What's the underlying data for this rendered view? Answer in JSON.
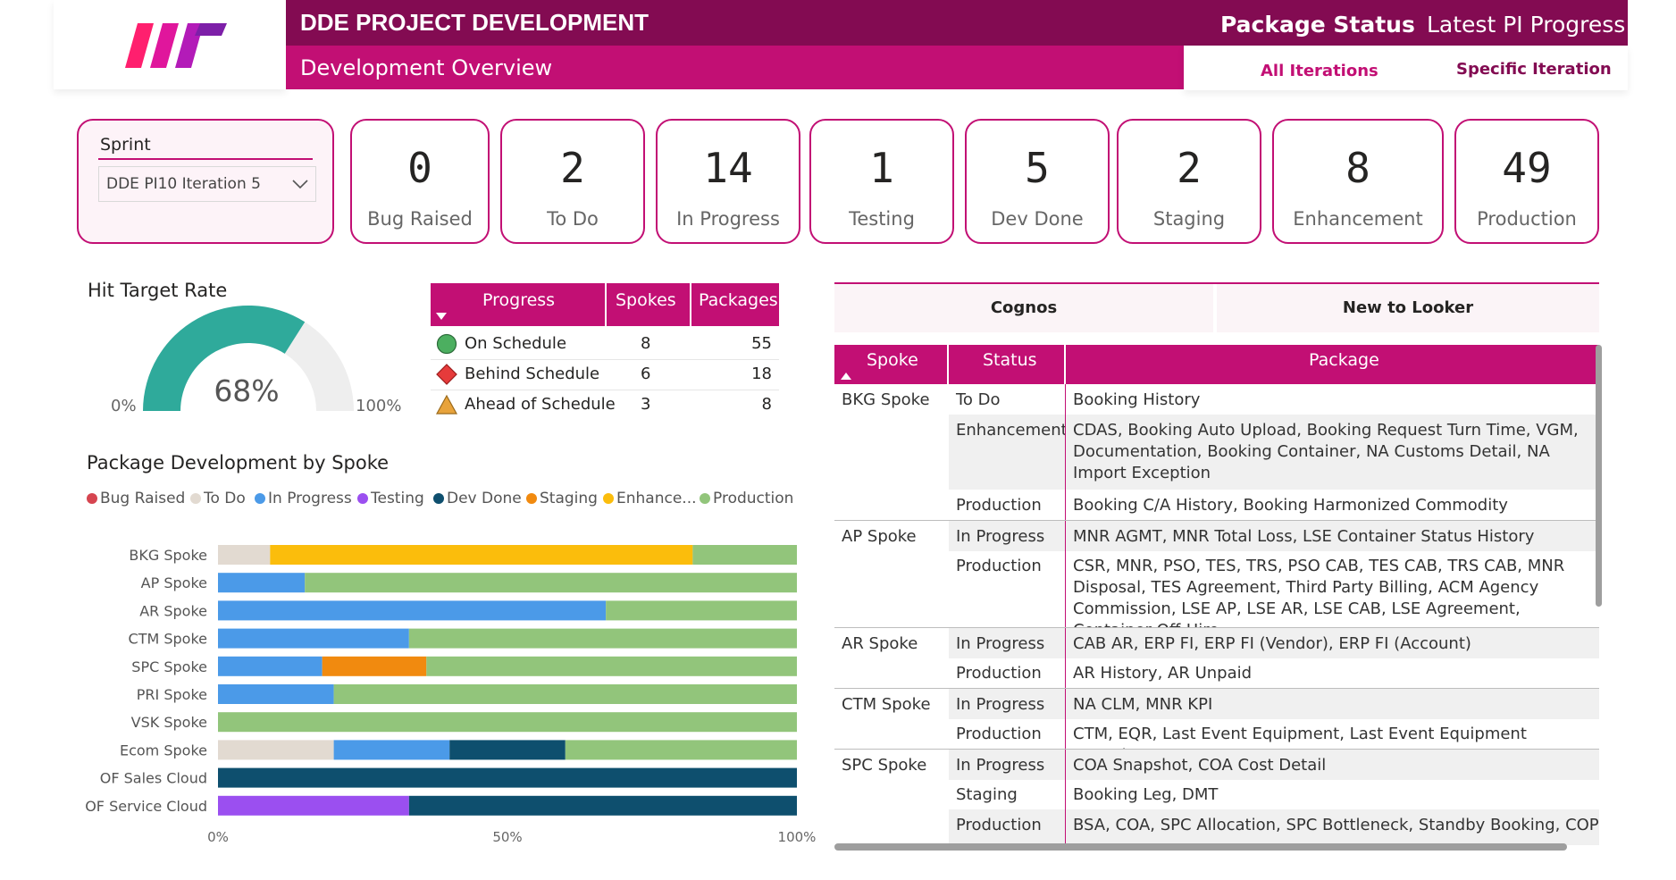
{
  "header": {
    "title": "DDE PROJECT DEVELOPMENT",
    "subtitle": "Development Overview",
    "nav": {
      "package_status": "Package Status",
      "latest_pi": "Latest PI Progress"
    },
    "tabs": {
      "all_iterations": "All Iterations",
      "specific_iteration": "Specific Iteration"
    }
  },
  "sprint": {
    "label": "Sprint",
    "value": "DDE PI10 Iteration 5"
  },
  "kpis": [
    {
      "value": "0",
      "label": "Bug Raised"
    },
    {
      "value": "2",
      "label": "To Do"
    },
    {
      "value": "14",
      "label": "In Progress"
    },
    {
      "value": "1",
      "label": "Testing"
    },
    {
      "value": "5",
      "label": "Dev Done"
    },
    {
      "value": "2",
      "label": "Staging"
    },
    {
      "value": "8",
      "label": "Enhancement"
    },
    {
      "value": "49",
      "label": "Production"
    }
  ],
  "gauge": {
    "title": "Hit Target Rate",
    "value_label": "68%",
    "value": 68,
    "min_label": "0%",
    "max_label": "100%",
    "color": "#2faa9b"
  },
  "progress_table": {
    "headers": {
      "progress": "Progress",
      "spokes": "Spokes",
      "packages": "Packages"
    },
    "rows": [
      {
        "label": "On Schedule",
        "spokes": "8",
        "packages": "55",
        "icon": "green-circle-icon"
      },
      {
        "label": "Behind Schedule",
        "spokes": "6",
        "packages": "18",
        "icon": "red-diamond-icon"
      },
      {
        "label": "Ahead of Schedule",
        "spokes": "3",
        "packages": "8",
        "icon": "orange-triangle-icon"
      }
    ]
  },
  "chart_data": {
    "type": "bar",
    "orientation": "horizontal-stacked-100",
    "title": "Package Development by Spoke",
    "categories": [
      "BKG Spoke",
      "AP Spoke",
      "AR Spoke",
      "CTM Spoke",
      "SPC Spoke",
      "PRI Spoke",
      "VSK Spoke",
      "Ecom Spoke",
      "OF Sales Cloud",
      "OF Service Cloud"
    ],
    "series": [
      {
        "name": "Bug Raised",
        "color": "#d64550",
        "values": [
          0,
          0,
          0,
          0,
          0,
          0,
          0,
          0,
          0,
          0
        ]
      },
      {
        "name": "To Do",
        "color": "#e2dad1",
        "values": [
          9,
          0,
          0,
          0,
          0,
          0,
          0,
          20,
          0,
          0
        ]
      },
      {
        "name": "In Progress",
        "color": "#4b9ae8",
        "values": [
          0,
          15,
          67,
          33,
          18,
          20,
          0,
          20,
          0,
          0
        ]
      },
      {
        "name": "Testing",
        "color": "#9b4ff0",
        "values": [
          0,
          0,
          0,
          0,
          0,
          0,
          0,
          0,
          0,
          33
        ]
      },
      {
        "name": "Dev Done",
        "color": "#0e4f6e",
        "values": [
          0,
          0,
          0,
          0,
          0,
          0,
          0,
          20,
          100,
          67
        ]
      },
      {
        "name": "Staging",
        "color": "#f18a0f",
        "values": [
          0,
          0,
          0,
          0,
          18,
          0,
          0,
          0,
          0,
          0
        ]
      },
      {
        "name": "Enhance...",
        "color": "#fbbd0c",
        "values": [
          73,
          0,
          0,
          0,
          0,
          0,
          0,
          0,
          0,
          0
        ]
      },
      {
        "name": "Production",
        "color": "#92c57b",
        "values": [
          18,
          85,
          33,
          67,
          64,
          80,
          100,
          40,
          0,
          0
        ]
      }
    ],
    "xlim": [
      0,
      100
    ],
    "xticks": [
      "0%",
      "50%",
      "100%"
    ],
    "legend": "top"
  },
  "buttons": {
    "cognos": "Cognos",
    "new_to_looker": "New to Looker"
  },
  "package_table": {
    "headers": {
      "spoke": "Spoke",
      "status": "Status",
      "package": "Package"
    },
    "rows": [
      {
        "spoke": "BKG Spoke",
        "status": "To Do",
        "package": "Booking History"
      },
      {
        "spoke": "",
        "status": "Enhancement",
        "package": "CDAS, Booking Auto Upload, Booking Request Turn Time, VGM, Documentation, Booking Container, NA Customs Detail, NA Import Exception"
      },
      {
        "spoke": "",
        "status": "Production",
        "package": "Booking C/A History, Booking Harmonized Commodity"
      },
      {
        "spoke": "AP Spoke",
        "status": "In Progress",
        "package": "MNR AGMT, MNR Total Loss, LSE Container Status History"
      },
      {
        "spoke": "",
        "status": "Production",
        "package": "CSR, MNR, PSO, TES, TRS, PSO CAB, TES CAB, TRS CAB, MNR Disposal, TES Agreement, Third Party Billing, ACM Agency Commission, LSE AP, LSE AR, LSE CAB, LSE Agreement, Container Off-Hire"
      },
      {
        "spoke": "AR Spoke",
        "status": "In Progress",
        "package": "CAB AR, ERP FI, ERP FI (Vendor), ERP FI (Account)"
      },
      {
        "spoke": "",
        "status": "Production",
        "package": "AR History, AR Unpaid"
      },
      {
        "spoke": "CTM Spoke",
        "status": "In Progress",
        "package": "NA CLM, MNR KPI"
      },
      {
        "spoke": "",
        "status": "Production",
        "package": "CTM, EQR, Last Event Equipment, Last Event Equipment Snapshot"
      },
      {
        "spoke": "SPC Spoke",
        "status": "In Progress",
        "package": "COA Snapshot, COA Cost Detail"
      },
      {
        "spoke": "",
        "status": "Staging",
        "package": "Booking Leg, DMT"
      },
      {
        "spoke": "",
        "status": "Production",
        "package": "BSA, COA, SPC Allocation, SPC Bottleneck, Standby Booking, COP (Dwell"
      }
    ]
  },
  "colors": {
    "primary_dark": "#830b52",
    "primary": "#c20f74"
  }
}
